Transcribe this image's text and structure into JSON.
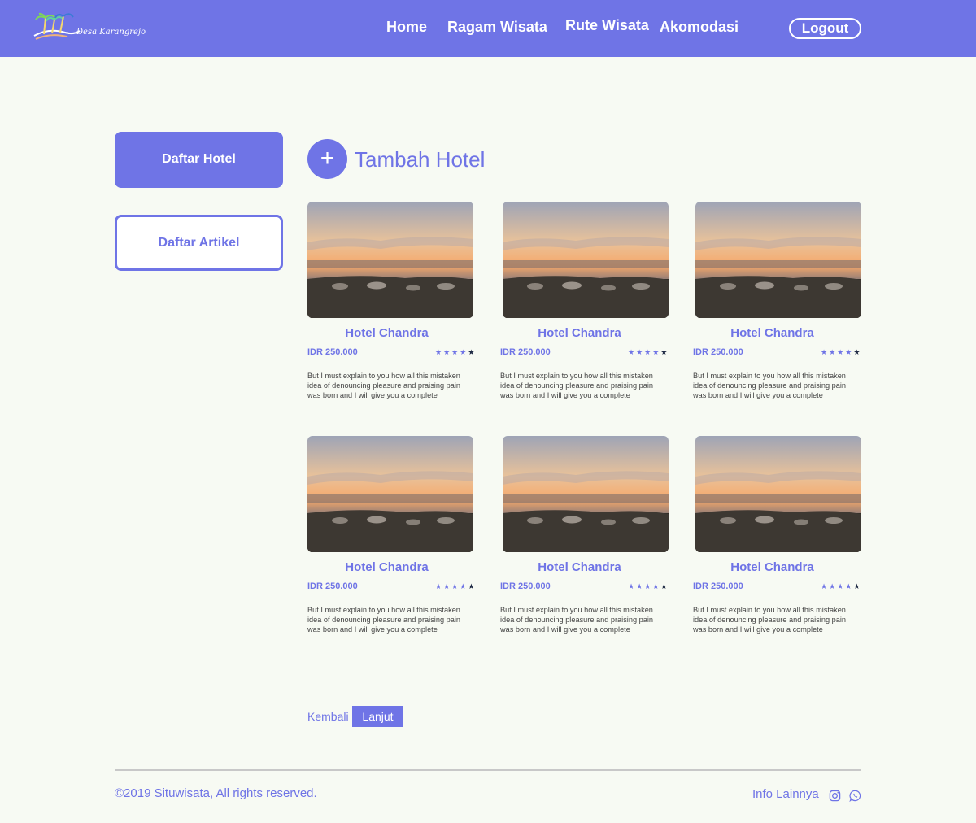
{
  "header": {
    "logo_icon": "palm-tree-island-logo",
    "logo_text": "Desa Karangrejo",
    "nav": [
      "Home",
      "Ragam Wisata",
      "Rute Wisata",
      "Akomodasi"
    ],
    "logout_label": "Logout"
  },
  "sidebar": {
    "items": [
      {
        "label": "Daftar Hotel",
        "active": true
      },
      {
        "label": "Daftar Artikel",
        "active": false
      }
    ]
  },
  "main": {
    "add_icon": "plus-icon",
    "add_label": "Tambah Hotel",
    "hotels": [
      {
        "name": "Hotel Chandra",
        "price": "IDR 250.000",
        "rating": 4,
        "rating_max": 5,
        "description": "But I must explain to you how all this mistaken idea of denouncing pleasure and praising pain was born and I will give you a complete"
      },
      {
        "name": "Hotel Chandra",
        "price": "IDR 250.000",
        "rating": 4,
        "rating_max": 5,
        "description": "But I must explain to you how all this mistaken idea of denouncing pleasure and praising pain was born and I will give you a complete"
      },
      {
        "name": "Hotel Chandra",
        "price": "IDR 250.000",
        "rating": 4,
        "rating_max": 5,
        "description": "But I must explain to you how all this mistaken idea of denouncing pleasure and praising pain was born and I will give you a complete"
      },
      {
        "name": "Hotel Chandra",
        "price": "IDR 250.000",
        "rating": 4,
        "rating_max": 5,
        "description": "But I must explain to you how all this mistaken idea of denouncing pleasure and praising pain was born and I will give you a complete"
      },
      {
        "name": "Hotel Chandra",
        "price": "IDR 250.000",
        "rating": 4,
        "rating_max": 5,
        "description": "But I must explain to you how all this mistaken idea of denouncing pleasure and praising pain was born and I will give you a complete"
      },
      {
        "name": "Hotel Chandra",
        "price": "IDR 250.000",
        "rating": 4,
        "rating_max": 5,
        "description": "But I must explain to you how all this mistaken idea of denouncing pleasure and praising pain was born and I will give you a complete"
      }
    ]
  },
  "pagination": {
    "prev_label": "Kembali",
    "next_label": "Lanjut"
  },
  "footer": {
    "copyright": "©2019 Situwisata, All rights reserved.",
    "info_label": "Info Lainnya",
    "icons": [
      "instagram-icon",
      "whatsapp-icon"
    ]
  },
  "colors": {
    "brand": "#6f74e6",
    "background": "#f7faf3",
    "star_last": "#1f2a44"
  }
}
